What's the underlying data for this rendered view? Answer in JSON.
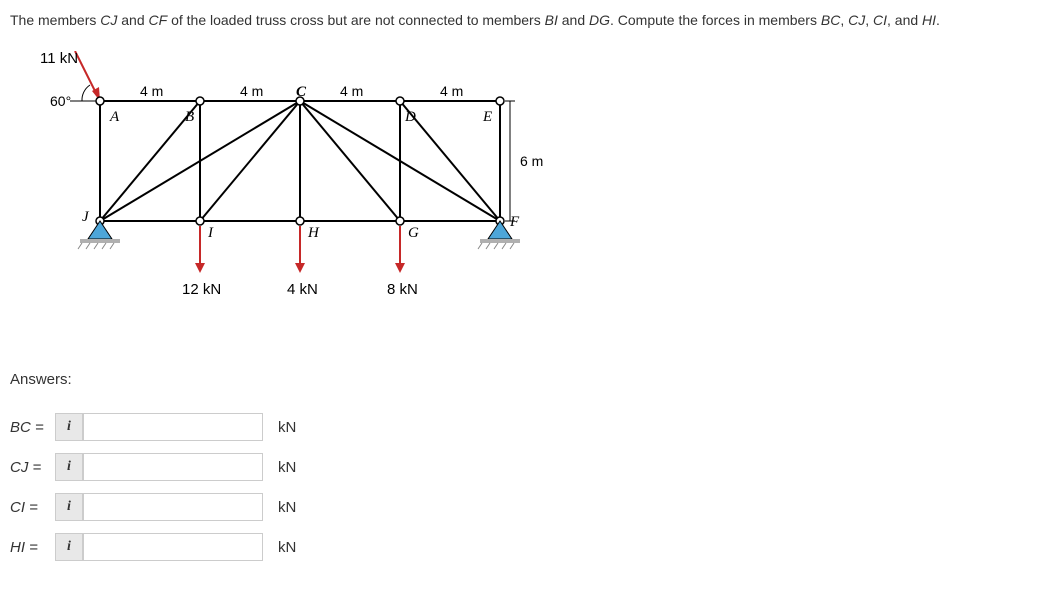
{
  "problem": {
    "text_part1": "The members ",
    "text_italic1": "CJ",
    "text_part2": " and ",
    "text_italic2": "CF",
    "text_part3": " of the loaded truss cross but are not connected to members ",
    "text_italic3": "BI",
    "text_part4": " and ",
    "text_italic4": "DG",
    "text_part5": ". Compute the forces in members ",
    "text_italic5": "BC",
    "text_part6": ", ",
    "text_italic6": "CJ",
    "text_part7": ", ",
    "text_italic7": "CI",
    "text_part8": ", and ",
    "text_italic8": "HI",
    "text_part9": "."
  },
  "diagram": {
    "force_top": "11 kN",
    "angle": "60°",
    "span1": "4 m",
    "span2": "4 m",
    "span3": "4 m",
    "span4": "4 m",
    "height": "6 m",
    "node_A": "A",
    "node_B": "B",
    "node_C": "C",
    "node_D": "D",
    "node_E": "E",
    "node_F": "F",
    "node_G": "G",
    "node_H": "H",
    "node_I": "I",
    "node_J": "J",
    "load_I": "12 kN",
    "load_H": "4 kN",
    "load_G": "8 kN"
  },
  "answers": {
    "heading": "Answers:",
    "rows": [
      {
        "label": "BC =",
        "info": "i",
        "unit": "kN"
      },
      {
        "label": "CJ =",
        "info": "i",
        "unit": "kN"
      },
      {
        "label": "CI =",
        "info": "i",
        "unit": "kN"
      },
      {
        "label": "HI =",
        "info": "i",
        "unit": "kN"
      }
    ]
  }
}
